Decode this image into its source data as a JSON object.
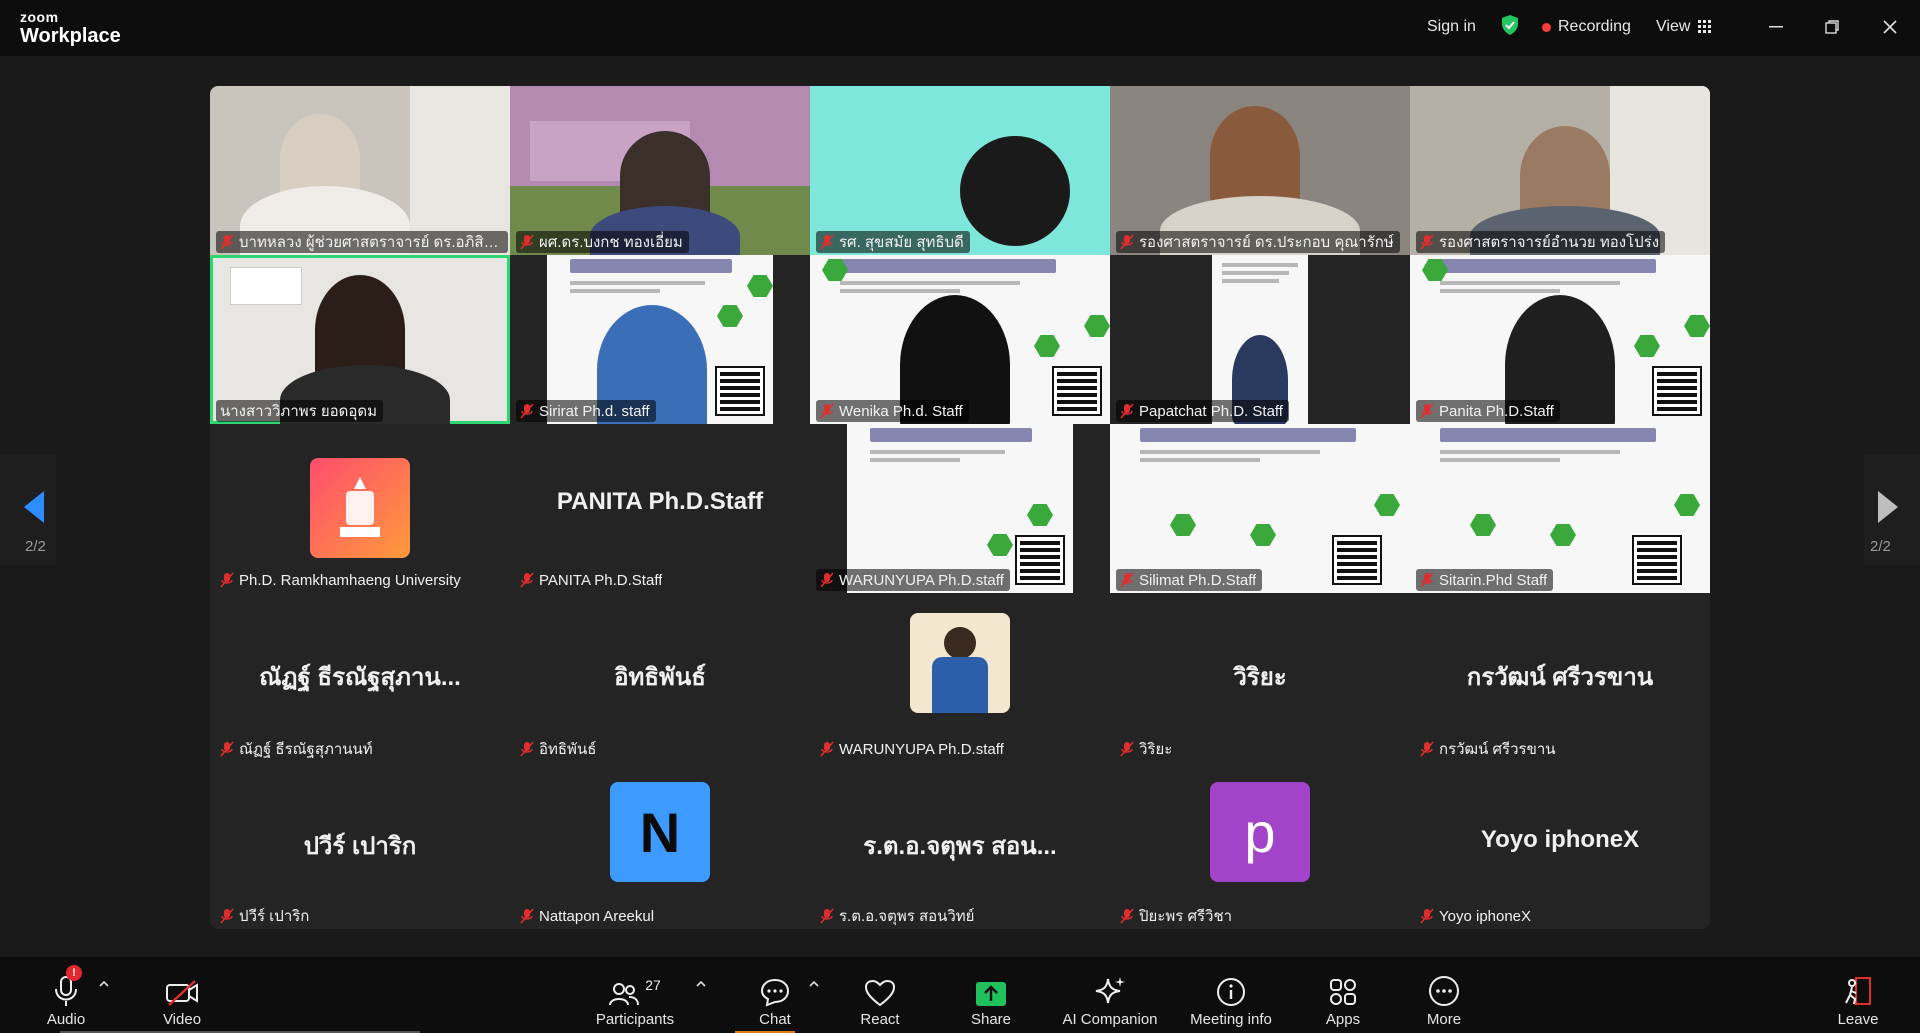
{
  "app": {
    "brand_top": "zoom",
    "brand_bottom": "Workplace"
  },
  "header": {
    "sign_in": "Sign in",
    "recording": "Recording",
    "view": "View"
  },
  "pager": {
    "left": "2/2",
    "right": "2/2"
  },
  "tiles": [
    {
      "name": "บาทหลวง ผู้ช่วยศาสตราจารย์ ดร.อภิสิทธิ์ ก..."
    },
    {
      "name": "ผศ.ดร.บงกช ทองเอี่ยม"
    },
    {
      "name": "รศ. สุขสมัย สุทธิบดี"
    },
    {
      "name": "รองศาสตราจารย์ ดร.ประกอบ คุณารักษ์"
    },
    {
      "name": "รองศาสตราจารย์อำนวย ทองโปร่ง"
    },
    {
      "name": "นางสาววิภาพร ยอดอุดม"
    },
    {
      "name": "Sirirat Ph.d. staff"
    },
    {
      "name": "Wenika Ph.d. Staff"
    },
    {
      "name": "Papatchat Ph.D. Staff"
    },
    {
      "name": "Panita Ph.D.Staff"
    },
    {
      "name": "Ph.D. Ramkhamhaeng University"
    },
    {
      "name": "PANITA Ph.D.Staff",
      "big": "PANITA Ph.D.Staff"
    },
    {
      "name": "WARUNYUPA Ph.D.staff"
    },
    {
      "name": "Silimat Ph.D.Staff"
    },
    {
      "name": "Sitarin.Phd Staff"
    },
    {
      "name": "ณัฏฐ์ ธีรณัฐสุภานนท์",
      "big": "ณัฏฐ์ ธีรณัฐสุภาน..."
    },
    {
      "name": "อิทธิพันธ์",
      "big": "อิทธิพันธ์"
    },
    {
      "name": "WARUNYUPA Ph.D.staff"
    },
    {
      "name": "วิริยะ",
      "big": "วิริยะ"
    },
    {
      "name": "กรวัฒน์ ศรีวรขาน",
      "big": "กรวัฒน์ ศรีวรขาน"
    },
    {
      "name": "ปวีร์ เปาริก",
      "big": "ปวีร์ เปาริก"
    },
    {
      "name": "Nattapon Areekul",
      "avatar": "N"
    },
    {
      "name": "ร.ต.อ.จตุพร สอนวิทย์",
      "big": "ร.ต.อ.จตุพร สอน..."
    },
    {
      "name": "ปิยะพร ศรีวิชา",
      "avatar": "p"
    },
    {
      "name": "Yoyo iphoneX",
      "big": "Yoyo iphoneX"
    }
  ],
  "toolbar": {
    "audio": "Audio",
    "video": "Video",
    "participants": "Participants",
    "participants_count": "27",
    "chat": "Chat",
    "react": "React",
    "share": "Share",
    "ai_companion": "AI Companion",
    "meeting_info": "Meeting info",
    "apps": "Apps",
    "more": "More",
    "leave": "Leave",
    "audio_badge": "!"
  },
  "colors": {
    "active_speaker": "#2ed573",
    "share_green": "#20c05c",
    "avatar_n": "#3d9bff",
    "avatar_p": "#a144c9",
    "recording_dot": "#ff3b3b"
  }
}
